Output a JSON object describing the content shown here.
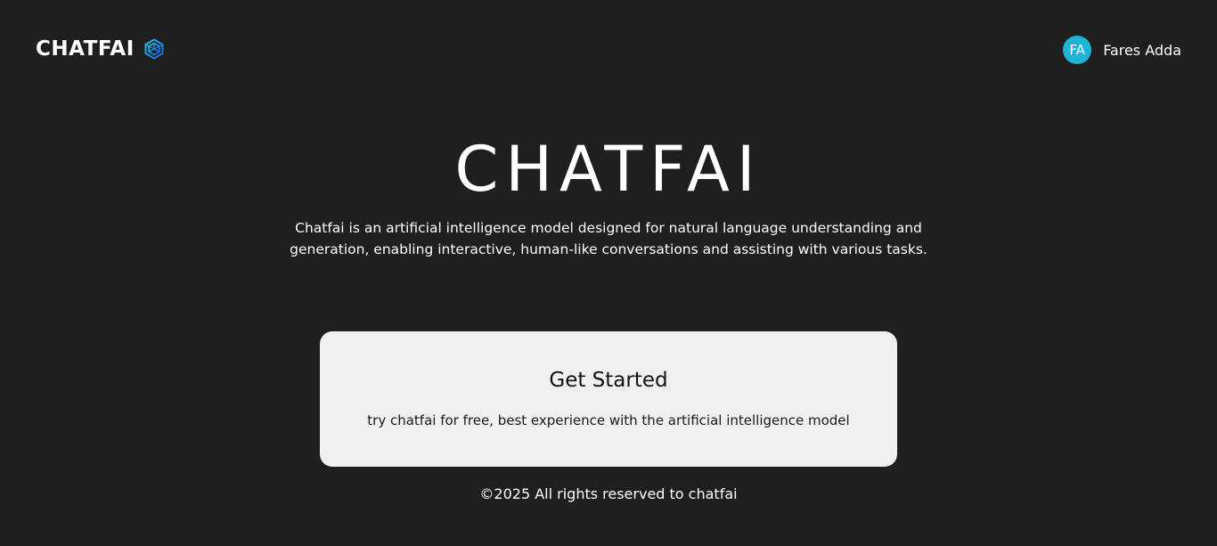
{
  "header": {
    "brand_name": "CHATFAI",
    "brand_icon": "hexagon-logo-icon",
    "user": {
      "initials": "FA",
      "name": "Fares Adda",
      "avatar_color": "#1fb3d6"
    }
  },
  "hero": {
    "title": "CHATFAI",
    "description": "Chatfai is an artificial intelligence model designed for natural language understanding and generation, enabling interactive, human-like conversations and assisting with various tasks."
  },
  "card": {
    "title": "Get Started",
    "description": "try chatfai for free, best experience with the artificial intelligence model"
  },
  "footer": {
    "text": "©2025 All rights reserved to chatfai"
  },
  "colors": {
    "background": "#1f1f1f",
    "card_background": "#f0f0f0",
    "accent": "#1fb3d6"
  }
}
